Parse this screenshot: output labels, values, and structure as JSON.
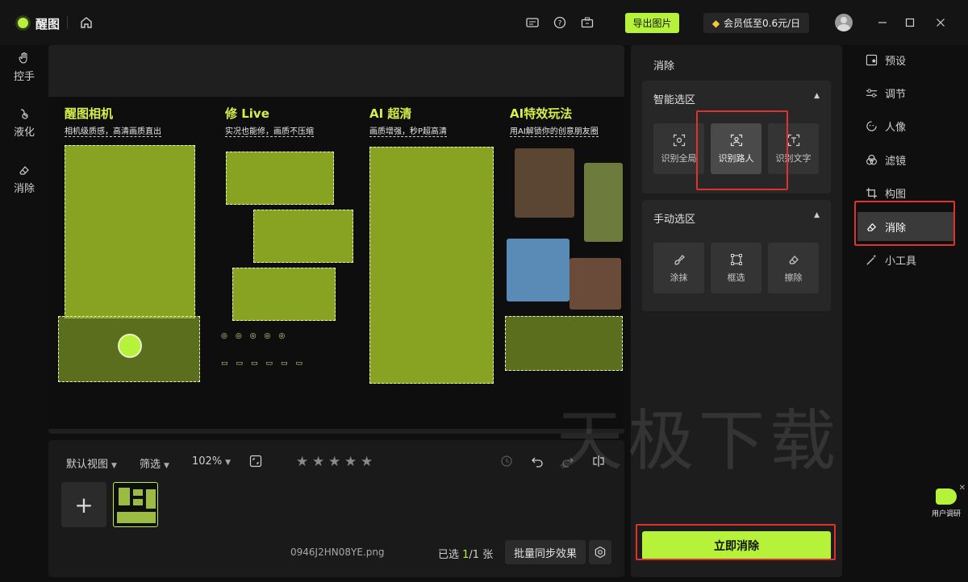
{
  "app": {
    "name": "醒图"
  },
  "titlebar": {
    "export_label": "导出图片",
    "vip_label": "会员低至0.6元/日"
  },
  "left_tools": [
    {
      "label": "控手",
      "icon": "hand-icon"
    },
    {
      "label": "液化",
      "icon": "liquify-icon"
    },
    {
      "label": "消除",
      "icon": "eraser-icon"
    }
  ],
  "canvas": {
    "sections": [
      {
        "title": "醒图相机",
        "subtitle": "相机级质感，高清画质直出"
      },
      {
        "title": "修 Live",
        "subtitle": "实况也能修，画质不压缩"
      },
      {
        "title": "AI 超清",
        "subtitle": "画质增强，秒P超高清"
      },
      {
        "title": "AI特效玩法",
        "subtitle": "用AI解锁你的创意朋友圈"
      }
    ]
  },
  "bottom": {
    "view_label": "默认视图",
    "filter_label": "筛选",
    "zoom_label": "102%",
    "rating": {
      "stars": 5,
      "filled": 0
    },
    "filename": "0946J2HN08YE.png",
    "selected_prefix": "已选 ",
    "selected_current": "1",
    "selected_suffix": "/1 张",
    "batch_label": "批量同步效果"
  },
  "panel": {
    "title": "消除",
    "smart_title": "智能选区",
    "smart_tools": [
      "识别全局",
      "识别路人",
      "识别文字"
    ],
    "smart_active_index": 1,
    "manual_title": "手动选区",
    "manual_tools": [
      "涂抹",
      "框选",
      "擦除"
    ],
    "erase_now_label": "立即消除"
  },
  "right_nav": [
    {
      "label": "预设",
      "icon": "preset-icon"
    },
    {
      "label": "调节",
      "icon": "adjust-icon"
    },
    {
      "label": "人像",
      "icon": "portrait-icon"
    },
    {
      "label": "滤镜",
      "icon": "filter-icon"
    },
    {
      "label": "构图",
      "icon": "crop-icon"
    },
    {
      "label": "消除",
      "icon": "eraser-icon"
    },
    {
      "label": "小工具",
      "icon": "magic-wand-icon"
    }
  ],
  "right_nav_active_index": 5,
  "watermark": "天极下载",
  "survey_label": "用户调研",
  "colors": {
    "accent": "#b6f23a",
    "highlight_box": "#e0322c"
  }
}
